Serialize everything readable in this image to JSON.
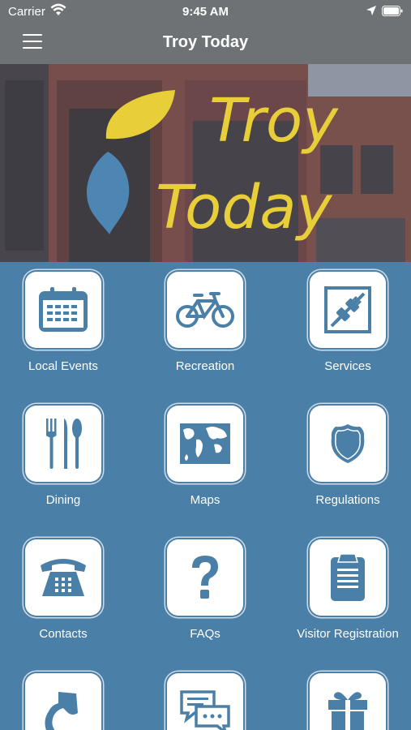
{
  "status_bar": {
    "carrier": "Carrier",
    "time": "9:45 AM"
  },
  "nav": {
    "title": "Troy Today"
  },
  "hero": {
    "line1": "Troy",
    "line2": "Today"
  },
  "colors": {
    "header": "#6f7275",
    "background": "#4a7fa7",
    "icon": "#4a7fa7",
    "logo_yellow": "#e8cf3a",
    "logo_blue": "#4d85b3"
  },
  "tiles": [
    {
      "label": "Local Events",
      "icon": "calendar-icon"
    },
    {
      "label": "Recreation",
      "icon": "bicycle-icon"
    },
    {
      "label": "Services",
      "icon": "plug-icon"
    },
    {
      "label": "Dining",
      "icon": "utensils-icon"
    },
    {
      "label": "Maps",
      "icon": "world-map-icon"
    },
    {
      "label": "Regulations",
      "icon": "shield-icon"
    },
    {
      "label": "Contacts",
      "icon": "telephone-icon"
    },
    {
      "label": "FAQs",
      "icon": "question-icon"
    },
    {
      "label": "Visitor Registration",
      "icon": "clipboard-icon"
    },
    {
      "label": "",
      "icon": "hand-icon"
    },
    {
      "label": "",
      "icon": "chat-icon"
    },
    {
      "label": "",
      "icon": "gift-icon"
    }
  ]
}
